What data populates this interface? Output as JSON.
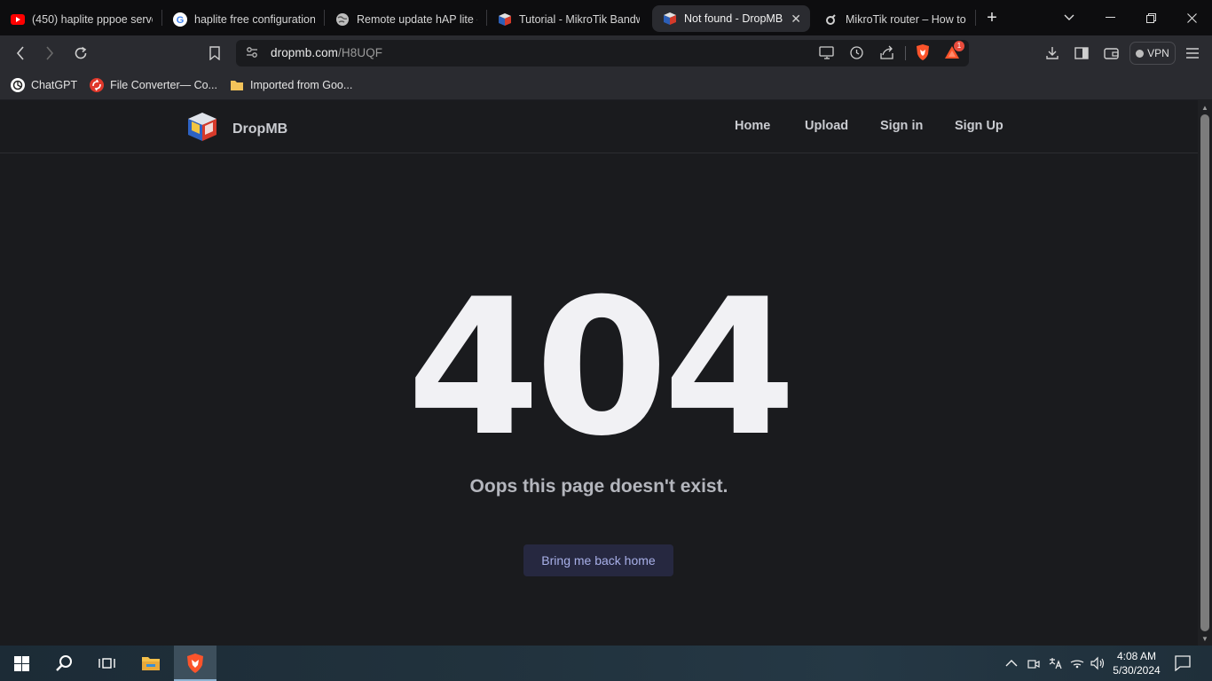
{
  "browser": {
    "tabs": [
      {
        "title": "(450) haplite pppoe server",
        "favicon": "youtube-icon",
        "active": false
      },
      {
        "title": "haplite free configuration",
        "favicon": "google-icon",
        "active": false
      },
      {
        "title": "Remote update hAP lite -",
        "favicon": "globe-icon",
        "active": false
      },
      {
        "title": "Tutorial - MikroTik Bandw",
        "favicon": "mikrotik-cube-icon",
        "active": false
      },
      {
        "title": "Not found - DropMB",
        "favicon": "dropmb-cube-icon",
        "active": true
      },
      {
        "title": "MikroTik router – How to",
        "favicon": "site-icon",
        "active": false
      }
    ],
    "url": {
      "host": "dropmb.com",
      "path": "/H8UQF"
    },
    "vpn_label": "VPN",
    "rewards_badge": "1",
    "bookmarks": [
      {
        "label": "ChatGPT",
        "icon": "chatgpt-icon"
      },
      {
        "label": "File Converter— Co...",
        "icon": "file-converter-icon"
      },
      {
        "label": "Imported from Goo...",
        "icon": "folder-icon"
      }
    ]
  },
  "site": {
    "brand": "DropMB",
    "nav": [
      "Home",
      "Upload",
      "Sign in",
      "Sign Up"
    ],
    "error_code": "404",
    "error_message": "Oops this page doesn't exist.",
    "home_button": "Bring me back home"
  },
  "taskbar": {
    "time": "4:08 AM",
    "date": "5/30/2024"
  },
  "colors": {
    "page_bg": "#1a1b1e",
    "button_bg": "#262840",
    "button_text": "#a8b0e8",
    "brave_orange": "#fb542b"
  }
}
